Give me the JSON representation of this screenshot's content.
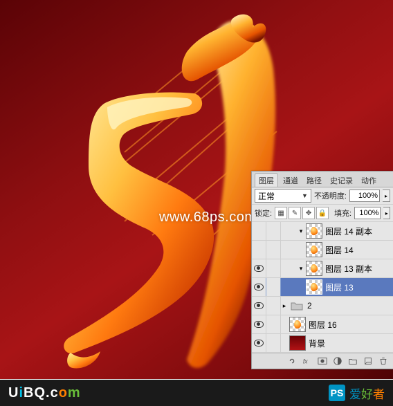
{
  "overlay_url": "www.68ps.com",
  "panel": {
    "tabs": [
      "图层",
      "通道",
      "路径",
      "史记录",
      "动作"
    ],
    "active_tab": 0,
    "blend_mode": "正常",
    "opacity_label": "不透明度:",
    "opacity_value": "100%",
    "lock_label": "锁定:",
    "fill_label": "填充:",
    "fill_value": "100%"
  },
  "layers": [
    {
      "visible": false,
      "indent": 2,
      "twisty": "▾",
      "thumb": "flame",
      "name": "图层 14 副本"
    },
    {
      "visible": false,
      "indent": 2,
      "twisty": "",
      "thumb": "flame",
      "name": "图层 14"
    },
    {
      "visible": true,
      "indent": 2,
      "twisty": "▾",
      "thumb": "flame",
      "name": "图层 13 副本"
    },
    {
      "visible": true,
      "indent": 2,
      "twisty": "",
      "thumb": "flame",
      "name": "图层 13",
      "selected": true
    },
    {
      "visible": true,
      "indent": 0,
      "twisty": "▸",
      "thumb": "folder",
      "name": "2"
    },
    {
      "visible": true,
      "indent": 0,
      "twisty": "",
      "thumb": "flame",
      "name": "图层 16"
    },
    {
      "visible": true,
      "indent": 0,
      "twisty": "",
      "thumb": "gradient",
      "name": "背景"
    }
  ],
  "sitebar": {
    "logo_text": "UiBQ.com",
    "stamp_label": "PS",
    "stamp_cn": "爱好者"
  }
}
